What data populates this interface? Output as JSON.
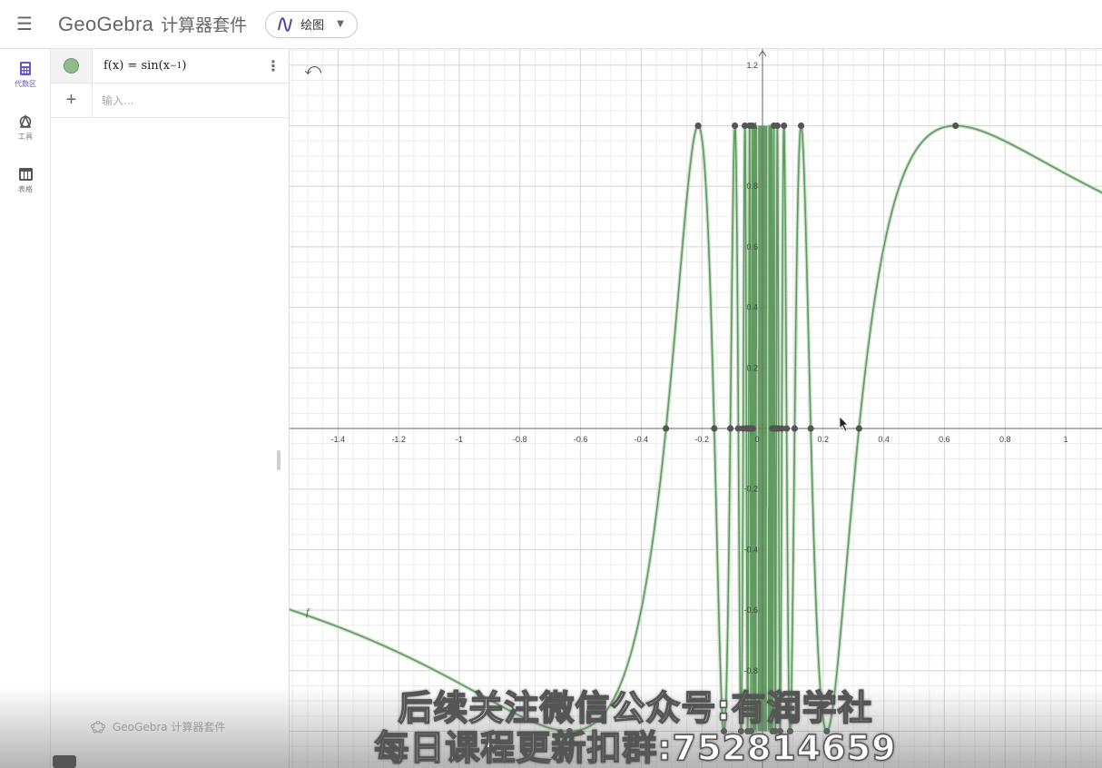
{
  "header": {
    "logo_text": "GeoGebra",
    "logo_sub": "计算器套件",
    "app_switch_label": "绘图"
  },
  "rail": [
    {
      "label": "代数区"
    },
    {
      "label": "工具"
    },
    {
      "label": "表格"
    }
  ],
  "algebra": {
    "formula_prefix": "f(x) = sin(x",
    "formula_exp": "−1",
    "formula_suffix": ")",
    "input_placeholder": "输入...",
    "footer": "GeoGebra 计算器套件"
  },
  "graph": {
    "function_label": "f",
    "x_ticks": [
      "-1.4",
      "-1.2",
      "-1",
      "-0.8",
      "-0.6",
      "-0.4",
      "-0.2",
      "0",
      "0.2",
      "0.4",
      "0.6",
      "0.8",
      "1"
    ],
    "y_ticks": [
      "1.2",
      "1",
      "0.8",
      "0.6",
      "0.4",
      "0.2",
      "-0.2",
      "-0.4",
      "-0.6",
      "-0.8"
    ],
    "curve_color": "#5f9a5f",
    "point_color": "#555555"
  },
  "overlay": {
    "line1": "后续关注微信公众号:有润学社",
    "line2": "每日课程更新扣群:752814659"
  }
}
